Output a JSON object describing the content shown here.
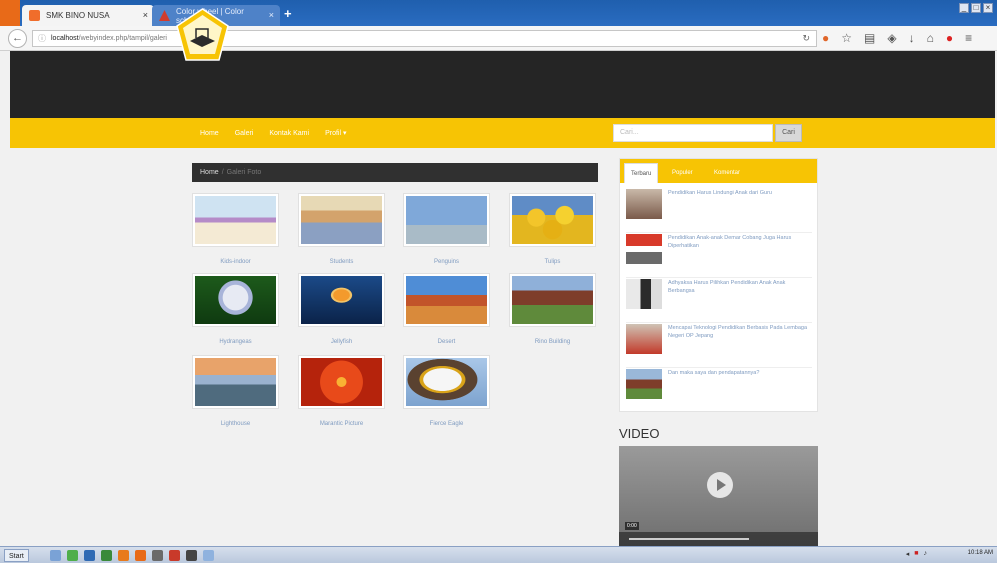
{
  "browser": {
    "tabs": [
      {
        "label": "SMK BINO NUSA",
        "active": true
      },
      {
        "label": "Color wheel | Color schemes -...",
        "active": false
      }
    ],
    "newtab": "+",
    "url_prefix": "localhost",
    "url_rest": "/webyindex.php/tampil/galeri"
  },
  "site": {
    "menu": [
      "Home",
      "Galeri",
      "Kontak Kami",
      "Profil ▾"
    ],
    "search_placeholder": "Cari...",
    "search_button": "Cari",
    "breadcrumb": {
      "home": "Home",
      "sep": "/",
      "current": "Galeri Foto"
    }
  },
  "gallery": [
    {
      "caption": "Kids-indoor"
    },
    {
      "caption": "Students"
    },
    {
      "caption": "Penguins"
    },
    {
      "caption": "Tulips"
    },
    {
      "caption": "Hydrangeas"
    },
    {
      "caption": "Jellyfish"
    },
    {
      "caption": "Desert"
    },
    {
      "caption": "Rino Building"
    },
    {
      "caption": "Lighthouse"
    },
    {
      "caption": "Marantic Picture"
    },
    {
      "caption": "Fierce Eagle"
    }
  ],
  "side": {
    "tabs": [
      "Terbaru",
      "Populer",
      "Komentar"
    ],
    "news": [
      {
        "title": "Pendidikan Harus Lindungi Anak dari Guru"
      },
      {
        "title": "Pendidikan Anak-anak Demar Cobang Juga Harus Diperhatikan"
      },
      {
        "title": "Adhyaksa Harus Pilihkan Pendidikan Anak Anak Berbangsa"
      },
      {
        "title": "Mencapai Teknologi Pendidikan Berbasis Pada Lembaga Negeri OP Jepang"
      },
      {
        "title": "Dan maka saya dan pendapatannya?"
      }
    ],
    "video_title": "VIDEO",
    "video_time": "0:00"
  },
  "taskbar": {
    "start": "Start",
    "clock": "10:18 AM"
  }
}
